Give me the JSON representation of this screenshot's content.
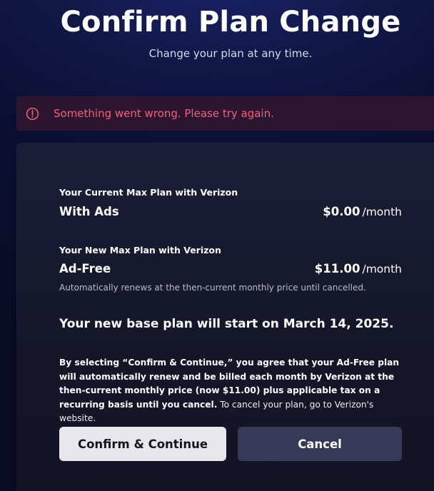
{
  "header": {
    "title": "Confirm Plan Change",
    "subtitle": "Change your plan at any time."
  },
  "error_banner": {
    "icon": "alert-circle-icon",
    "message": "Something went wrong. Please try again.",
    "color": "#f0607a"
  },
  "current_plan": {
    "label": "Your Current Max Plan with Verizon",
    "name": "With Ads",
    "price": "$0.00",
    "period": "/month"
  },
  "new_plan": {
    "label": "Your New Max Plan with Verizon",
    "name": "Ad-Free",
    "price": "$11.00",
    "period": "/month",
    "renew_note": "Automatically renews at the then-current monthly price until cancelled."
  },
  "start_notice": "Your new base plan will start on March 14, 2025.",
  "legal": {
    "bold_text": "By selecting “Confirm & Continue,” you agree that your Ad-Free plan will automatically renew and be billed each month by Verizon at the then-current monthly price (now $11.00) plus applicable tax on a recurring basis until you cancel.",
    "normal_text": " To cancel your plan, go to Verizon's website."
  },
  "buttons": {
    "confirm_label": "Confirm & Continue",
    "cancel_label": "Cancel"
  }
}
